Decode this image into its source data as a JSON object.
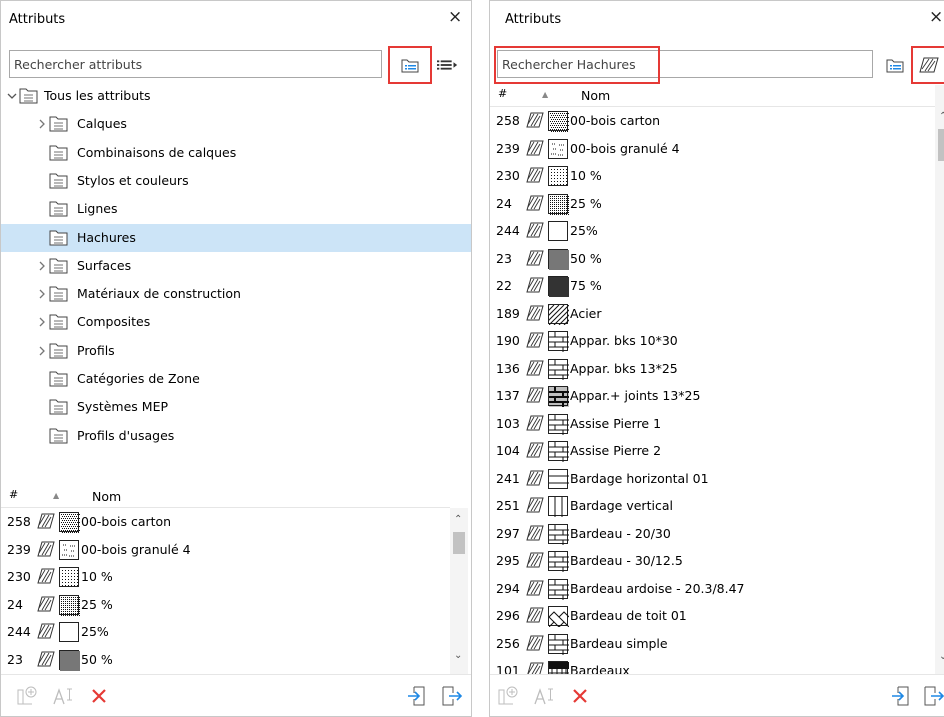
{
  "left": {
    "title": "Attributs",
    "close": "×",
    "search_placeholder": "Rechercher attributs",
    "tree": [
      {
        "label": "Tous les attributs",
        "icon": "all-attributes-folder-icon",
        "expander": "open",
        "level": 0
      },
      {
        "label": "Calques",
        "icon": "layers-folder-icon",
        "expander": "closed",
        "level": 1
      },
      {
        "label": "Combinaisons de calques",
        "icon": "layer-combinations-folder-icon",
        "expander": "none",
        "level": 1
      },
      {
        "label": "Stylos et couleurs",
        "icon": "pens-colors-folder-icon",
        "expander": "none",
        "level": 1
      },
      {
        "label": "Lignes",
        "icon": "lines-folder-icon",
        "expander": "none",
        "level": 1
      },
      {
        "label": "Hachures",
        "icon": "fills-folder-icon",
        "expander": "none",
        "level": 1,
        "selected": true
      },
      {
        "label": "Surfaces",
        "icon": "surfaces-folder-icon",
        "expander": "closed",
        "level": 1
      },
      {
        "label": "Matériaux de construction",
        "icon": "building-materials-folder-icon",
        "expander": "closed",
        "level": 1
      },
      {
        "label": "Composites",
        "icon": "composites-folder-icon",
        "expander": "closed",
        "level": 1
      },
      {
        "label": "Profils",
        "icon": "profiles-folder-icon",
        "expander": "closed",
        "level": 1
      },
      {
        "label": "Catégories de Zone",
        "icon": "zone-categories-folder-icon",
        "expander": "none",
        "level": 1
      },
      {
        "label": "Systèmes MEP",
        "icon": "mep-systems-folder-icon",
        "expander": "none",
        "level": 1
      },
      {
        "label": "Profils d'usages",
        "icon": "operation-profiles-folder-icon",
        "expander": "none",
        "level": 1
      }
    ],
    "list_header": {
      "num": "#",
      "sort": "▲",
      "name": "Nom"
    },
    "rows": [
      {
        "num": "258",
        "name": "00-bois carton",
        "pattern": "dense"
      },
      {
        "num": "239",
        "name": "00-bois granulé 4",
        "pattern": "granule"
      },
      {
        "num": "230",
        "name": "10 %",
        "pattern": "light"
      },
      {
        "num": "24",
        "name": "25 %",
        "pattern": "medium"
      },
      {
        "num": "244",
        "name": "25%",
        "pattern": "empty"
      },
      {
        "num": "23",
        "name": "50 %",
        "pattern": "dark"
      }
    ]
  },
  "right": {
    "title": "Attributs",
    "close": "×",
    "search_placeholder": "Rechercher Hachures",
    "list_header": {
      "num": "#",
      "sort": "▲",
      "name": "Nom"
    },
    "rows": [
      {
        "num": "258",
        "name": "00-bois carton",
        "pattern": "dense"
      },
      {
        "num": "239",
        "name": "00-bois granulé 4",
        "pattern": "granule"
      },
      {
        "num": "230",
        "name": "10 %",
        "pattern": "light"
      },
      {
        "num": "24",
        "name": "25 %",
        "pattern": "medium"
      },
      {
        "num": "244",
        "name": "25%",
        "pattern": "empty"
      },
      {
        "num": "23",
        "name": "50 %",
        "pattern": "dark"
      },
      {
        "num": "22",
        "name": "75 %",
        "pattern": "darker"
      },
      {
        "num": "189",
        "name": "Acier",
        "pattern": "diag"
      },
      {
        "num": "190",
        "name": "Appar. bks 10*30",
        "pattern": "brick"
      },
      {
        "num": "136",
        "name": "Appar. bks 13*25",
        "pattern": "brick"
      },
      {
        "num": "137",
        "name": "Appar.+ joints 13*25",
        "pattern": "brickdark"
      },
      {
        "num": "103",
        "name": "Assise Pierre 1",
        "pattern": "brick"
      },
      {
        "num": "104",
        "name": "Assise Pierre 2",
        "pattern": "brick"
      },
      {
        "num": "241",
        "name": "Bardage horizontal 01",
        "pattern": "hlines"
      },
      {
        "num": "251",
        "name": "Bardage vertical",
        "pattern": "vlines"
      },
      {
        "num": "297",
        "name": "Bardeau - 20/30",
        "pattern": "brick"
      },
      {
        "num": "295",
        "name": "Bardeau - 30/12.5",
        "pattern": "brick"
      },
      {
        "num": "294",
        "name": "Bardeau ardoise - 20.3/8.47",
        "pattern": "brick"
      },
      {
        "num": "296",
        "name": "Bardeau de toit 01",
        "pattern": "scale"
      },
      {
        "num": "256",
        "name": "Bardeau simple",
        "pattern": "brick"
      },
      {
        "num": "101",
        "name": "Bardeaux",
        "pattern": "shingle"
      }
    ]
  },
  "footer": {
    "left_icons": [
      "new-attribute-icon",
      "rename-icon",
      "delete-icon"
    ],
    "right_icons": [
      "import-icon",
      "export-icon"
    ]
  },
  "colors": {
    "highlight": "#e53935",
    "selection": "#cce4f7",
    "delete": "#e53935",
    "import_export": "#1e88e5"
  }
}
